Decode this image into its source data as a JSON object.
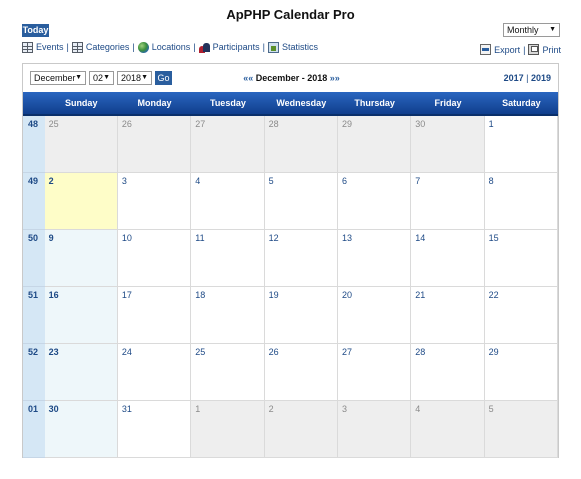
{
  "app": {
    "title": "ApPHP Calendar Pro",
    "today_label": "Today",
    "view_mode": "Monthly"
  },
  "nav": {
    "events": "Events",
    "categories": "Categories",
    "locations": "Locations",
    "participants": "Participants",
    "statistics": "Statistics",
    "separator": "|"
  },
  "actions": {
    "export": "Export",
    "print": "Print"
  },
  "icons": [
    "events-icon",
    "categories-icon",
    "locations-globe-icon",
    "participants-icon",
    "statistics-icon",
    "export-icon",
    "print-icon"
  ],
  "toolbar": {
    "month": "December",
    "day": "02",
    "year": "2018",
    "go": "Go",
    "prev": "««",
    "next": "»»",
    "period": "December - 2018",
    "year_prev": "2017",
    "year_next": "2019"
  },
  "day_headers": [
    "Sunday",
    "Monday",
    "Tuesday",
    "Wednesday",
    "Thursday",
    "Friday",
    "Saturday"
  ],
  "weeks": [
    {
      "num": "48",
      "days": [
        "25",
        "26",
        "27",
        "28",
        "29",
        "30",
        "1"
      ],
      "types": [
        "other",
        "other",
        "other",
        "other",
        "other",
        "other",
        "cur"
      ]
    },
    {
      "num": "49",
      "days": [
        "2",
        "3",
        "4",
        "5",
        "6",
        "7",
        "8"
      ],
      "types": [
        "today",
        "cur",
        "cur",
        "cur",
        "cur",
        "cur",
        "cur"
      ]
    },
    {
      "num": "50",
      "days": [
        "9",
        "10",
        "11",
        "12",
        "13",
        "14",
        "15"
      ],
      "types": [
        "sunday",
        "cur",
        "cur",
        "cur",
        "cur",
        "cur",
        "cur"
      ]
    },
    {
      "num": "51",
      "days": [
        "16",
        "17",
        "18",
        "19",
        "20",
        "21",
        "22"
      ],
      "types": [
        "sunday",
        "cur",
        "cur",
        "cur",
        "cur",
        "cur",
        "cur"
      ]
    },
    {
      "num": "52",
      "days": [
        "23",
        "24",
        "25",
        "26",
        "27",
        "28",
        "29"
      ],
      "types": [
        "sunday",
        "cur",
        "cur",
        "cur",
        "cur",
        "cur",
        "cur"
      ]
    },
    {
      "num": "01",
      "days": [
        "30",
        "31",
        "1",
        "2",
        "3",
        "4",
        "5"
      ],
      "types": [
        "sunday",
        "cur",
        "other",
        "other",
        "other",
        "other",
        "other"
      ]
    }
  ],
  "colors": {
    "accent": "#2a5e9e",
    "header_top": "#2a66c0",
    "header_bottom": "#103e8c",
    "today": "#fefdc8",
    "other_month": "#eeeeee",
    "week_col": "#d5e7f5",
    "sunday": "#eef7fa",
    "link": "#1e4a86"
  }
}
